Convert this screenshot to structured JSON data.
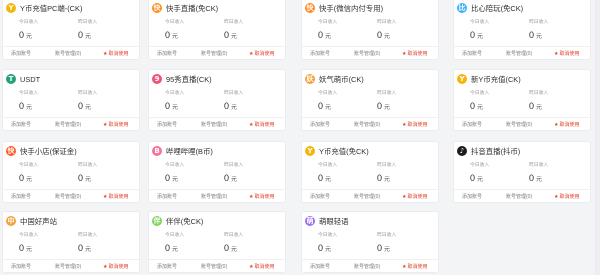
{
  "colors": {
    "cancel": "#e0402b",
    "card_bg": "#ffffff",
    "page_bg": "#f3f4f6"
  },
  "cards": [
    {
      "title": "Y币充值PC端-(CK)",
      "icon": "y-coin-icon",
      "logo_color": "#f5b50a",
      "logo_char": "Y",
      "stat1_label": "今日收入",
      "stat1_value": "0",
      "stat1_unit": "元",
      "stat2_label": "昨日收入",
      "stat2_value": "0",
      "stat2_unit": "元",
      "link1": "添加账号",
      "link2": "账号管理(0)",
      "cancel": "取消使用"
    },
    {
      "title": "快手直播(免CK)",
      "icon": "kuaishou-icon",
      "logo_color": "#ff8a1c",
      "logo_char": "快",
      "stat1_label": "今日收入",
      "stat1_value": "0",
      "stat1_unit": "元",
      "stat2_label": "昨日收入",
      "stat2_value": "0",
      "stat2_unit": "元",
      "link1": "添加账号",
      "link2": "账号管理(0)",
      "cancel": "取消使用"
    },
    {
      "title": "快手(微信内付专用)",
      "icon": "kuaishou-icon",
      "logo_color": "#ff8a1c",
      "logo_char": "快",
      "stat1_label": "今日收入",
      "stat1_value": "0",
      "stat1_unit": "元",
      "stat2_label": "昨日收入",
      "stat2_value": "0",
      "stat2_unit": "元",
      "link1": "添加账号",
      "link2": "账号管理(0)",
      "cancel": "取消使用"
    },
    {
      "title": "比心陪玩(免CK)",
      "icon": "bixin-icon",
      "logo_color": "#3db3f5",
      "logo_char": "比",
      "stat1_label": "今日收入",
      "stat1_value": "0",
      "stat1_unit": "元",
      "stat2_label": "昨日收入",
      "stat2_value": "0",
      "stat2_unit": "元",
      "link1": "添加账号",
      "link2": "账号管理(0)",
      "cancel": "取消使用"
    },
    {
      "title": "USDT",
      "icon": "usdt-icon",
      "logo_color": "#26a17b",
      "logo_char": "T",
      "stat1_label": "今日收入",
      "stat1_value": "0",
      "stat1_unit": "元",
      "stat2_label": "昨日收入",
      "stat2_value": "0",
      "stat2_unit": "元",
      "link1": "添加账号",
      "link2": "账号管理(0)",
      "cancel": "取消使用"
    },
    {
      "title": "95秀直播(CK)",
      "icon": "95xiu-icon",
      "logo_color": "#f0537a",
      "logo_char": "9",
      "stat1_label": "今日收入",
      "stat1_value": "0",
      "stat1_unit": "元",
      "stat2_label": "昨日收入",
      "stat2_value": "0",
      "stat2_unit": "元",
      "link1": "添加账号",
      "link2": "账号管理(0)",
      "cancel": "取消使用"
    },
    {
      "title": "妖气萌币(CK)",
      "icon": "yaoqi-icon",
      "logo_color": "#f2a23c",
      "logo_char": "妖",
      "stat1_label": "今日收入",
      "stat1_value": "0",
      "stat1_unit": "元",
      "stat2_label": "昨日收入",
      "stat2_value": "0",
      "stat2_unit": "元",
      "link1": "添加账号",
      "link2": "账号管理(0)",
      "cancel": "取消使用"
    },
    {
      "title": "新Y币充值(CK)",
      "icon": "y-coin-icon",
      "logo_color": "#f5b50a",
      "logo_char": "Y",
      "stat1_label": "今日收入",
      "stat1_value": "0",
      "stat1_unit": "元",
      "stat2_label": "昨日收入",
      "stat2_value": "0",
      "stat2_unit": "元",
      "link1": "添加账号",
      "link2": "账号管理(0)",
      "cancel": "取消使用"
    },
    {
      "title": "快手小店(保证金)",
      "icon": "kuaishou-shop-icon",
      "logo_color": "#ff5722",
      "logo_char": "快",
      "stat1_label": "今日收入",
      "stat1_value": "0",
      "stat1_unit": "元",
      "stat2_label": "昨日收入",
      "stat2_value": "0",
      "stat2_unit": "元",
      "link1": "添加账号",
      "link2": "账号管理(0)",
      "cancel": "取消使用"
    },
    {
      "title": "哔哩哔哩(B币)",
      "icon": "bilibili-icon",
      "logo_color": "#fb7299",
      "logo_char": "B",
      "stat1_label": "今日收入",
      "stat1_value": "0",
      "stat1_unit": "元",
      "stat2_label": "昨日收入",
      "stat2_value": "0",
      "stat2_unit": "元",
      "link1": "添加账号",
      "link2": "账号管理(0)",
      "cancel": "取消使用"
    },
    {
      "title": "Y币充值(免CK)",
      "icon": "y-coin-icon",
      "logo_color": "#f5b50a",
      "logo_char": "Y",
      "stat1_label": "今日收入",
      "stat1_value": "0",
      "stat1_unit": "元",
      "stat2_label": "昨日收入",
      "stat2_value": "0",
      "stat2_unit": "元",
      "link1": "添加账号",
      "link2": "账号管理(0)",
      "cancel": "取消使用"
    },
    {
      "title": "抖音直播(抖币)",
      "icon": "douyin-icon",
      "logo_color": "#1c1c1c",
      "logo_char": "♪",
      "stat1_label": "今日收入",
      "stat1_value": "0",
      "stat1_unit": "元",
      "stat2_label": "昨日收入",
      "stat2_value": "0",
      "stat2_unit": "元",
      "link1": "添加账号",
      "link2": "账号管理(0)",
      "cancel": "取消使用"
    },
    {
      "title": "中国好声站",
      "icon": "haoshengyin-icon",
      "logo_color": "#f2a23c",
      "logo_char": "中",
      "stat1_label": "今日收入",
      "stat1_value": "0",
      "stat1_unit": "元",
      "stat2_label": "昨日收入",
      "stat2_value": "0",
      "stat2_unit": "元",
      "link1": "添加账号",
      "link2": "账号管理(0)",
      "cancel": "取消使用"
    },
    {
      "title": "伴伴(免CK)",
      "icon": "banban-icon",
      "logo_color": "#7bd35a",
      "logo_char": "伴",
      "stat1_label": "今日收入",
      "stat1_value": "0",
      "stat1_unit": "元",
      "stat2_label": "昨日收入",
      "stat2_value": "0",
      "stat2_unit": "元",
      "link1": "添加账号",
      "link2": "账号管理(0)",
      "cancel": "取消使用"
    },
    {
      "title": "萌眼轻语",
      "icon": "mengyan-icon",
      "logo_color": "#9b6cf0",
      "logo_char": "萌",
      "stat1_label": "今日收入",
      "stat1_value": "0",
      "stat1_unit": "元",
      "stat2_label": "昨日收入",
      "stat2_value": "0",
      "stat2_unit": "元",
      "link1": "添加账号",
      "link2": "账号管理(0)",
      "cancel": "取消使用"
    }
  ]
}
